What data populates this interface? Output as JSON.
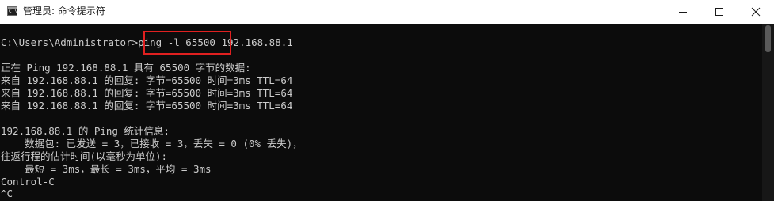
{
  "window": {
    "title": "管理员: 命令提示符",
    "icon": "cmd-icon",
    "icon_text": "C:\\"
  },
  "controls": {
    "minimize": "minimize-icon",
    "maximize": "maximize-icon",
    "close": "close-icon"
  },
  "console": {
    "prompt": "C:\\Users\\Administrator>",
    "command": "ping -l 65500",
    "target": " 192.168.88.1",
    "lines": [
      "正在 Ping 192.168.88.1 具有 65500 字节的数据:",
      "来自 192.168.88.1 的回复: 字节=65500 时间=3ms TTL=64",
      "来自 192.168.88.1 的回复: 字节=65500 时间=3ms TTL=64",
      "来自 192.168.88.1 的回复: 字节=65500 时间=3ms TTL=64",
      "",
      "192.168.88.1 的 Ping 统计信息:",
      "    数据包: 已发送 = 3，已接收 = 3，丢失 = 0 (0% 丢失)，",
      "往返行程的估计时间(以毫秒为单位):",
      "    最短 = 3ms，最长 = 3ms，平均 = 3ms",
      "Control-C",
      "^C"
    ]
  },
  "colors": {
    "console_bg": "#0c0c0c",
    "console_text": "#cccccc",
    "highlight_border": "#e02020",
    "titlebar_bg": "#ffffff"
  }
}
